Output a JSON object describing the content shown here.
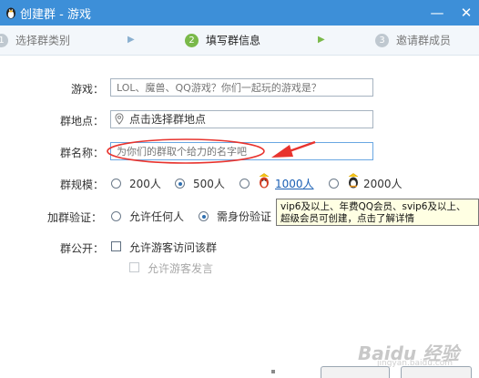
{
  "window": {
    "title": "创建群 - 游戏",
    "minimize": "—",
    "close": "✕"
  },
  "steps": [
    {
      "num": "1",
      "label": "选择群类别"
    },
    {
      "num": "2",
      "label": "填写群信息"
    },
    {
      "num": "3",
      "label": "邀请群成员"
    }
  ],
  "form": {
    "game_label": "游戏：",
    "game_placeholder": "LOL、魔兽、QQ游戏？你们一起玩的游戏是？",
    "location_label": "群地点：",
    "location_placeholder": "点击选择群地点",
    "name_label": "群名称：",
    "name_placeholder": "为你们的群取个给力的名字吧",
    "size_label": "群规模：",
    "size_options": [
      "200人",
      "500人",
      "1000人",
      "2000人"
    ],
    "size_selected": "500人",
    "verify_label": "加群验证：",
    "verify_options": [
      "允许任何人",
      "需身份验证"
    ],
    "verify_selected": "需身份验证",
    "public_label": "群公开：",
    "public_options": [
      "允许游客访问该群",
      "允许游客发言"
    ]
  },
  "tooltip": {
    "line1": "vip6及以上、年费QQ会员、svip6及以上、",
    "line2": "超级会员可创建，点击了解详情"
  },
  "watermark": {
    "main": "Baidu 经验",
    "sub": "jingyan.baidu.com"
  },
  "colors": {
    "titlebar": "#3d8fd8",
    "step_active": "#7ab94a",
    "annotation_red": "#e8332e"
  }
}
